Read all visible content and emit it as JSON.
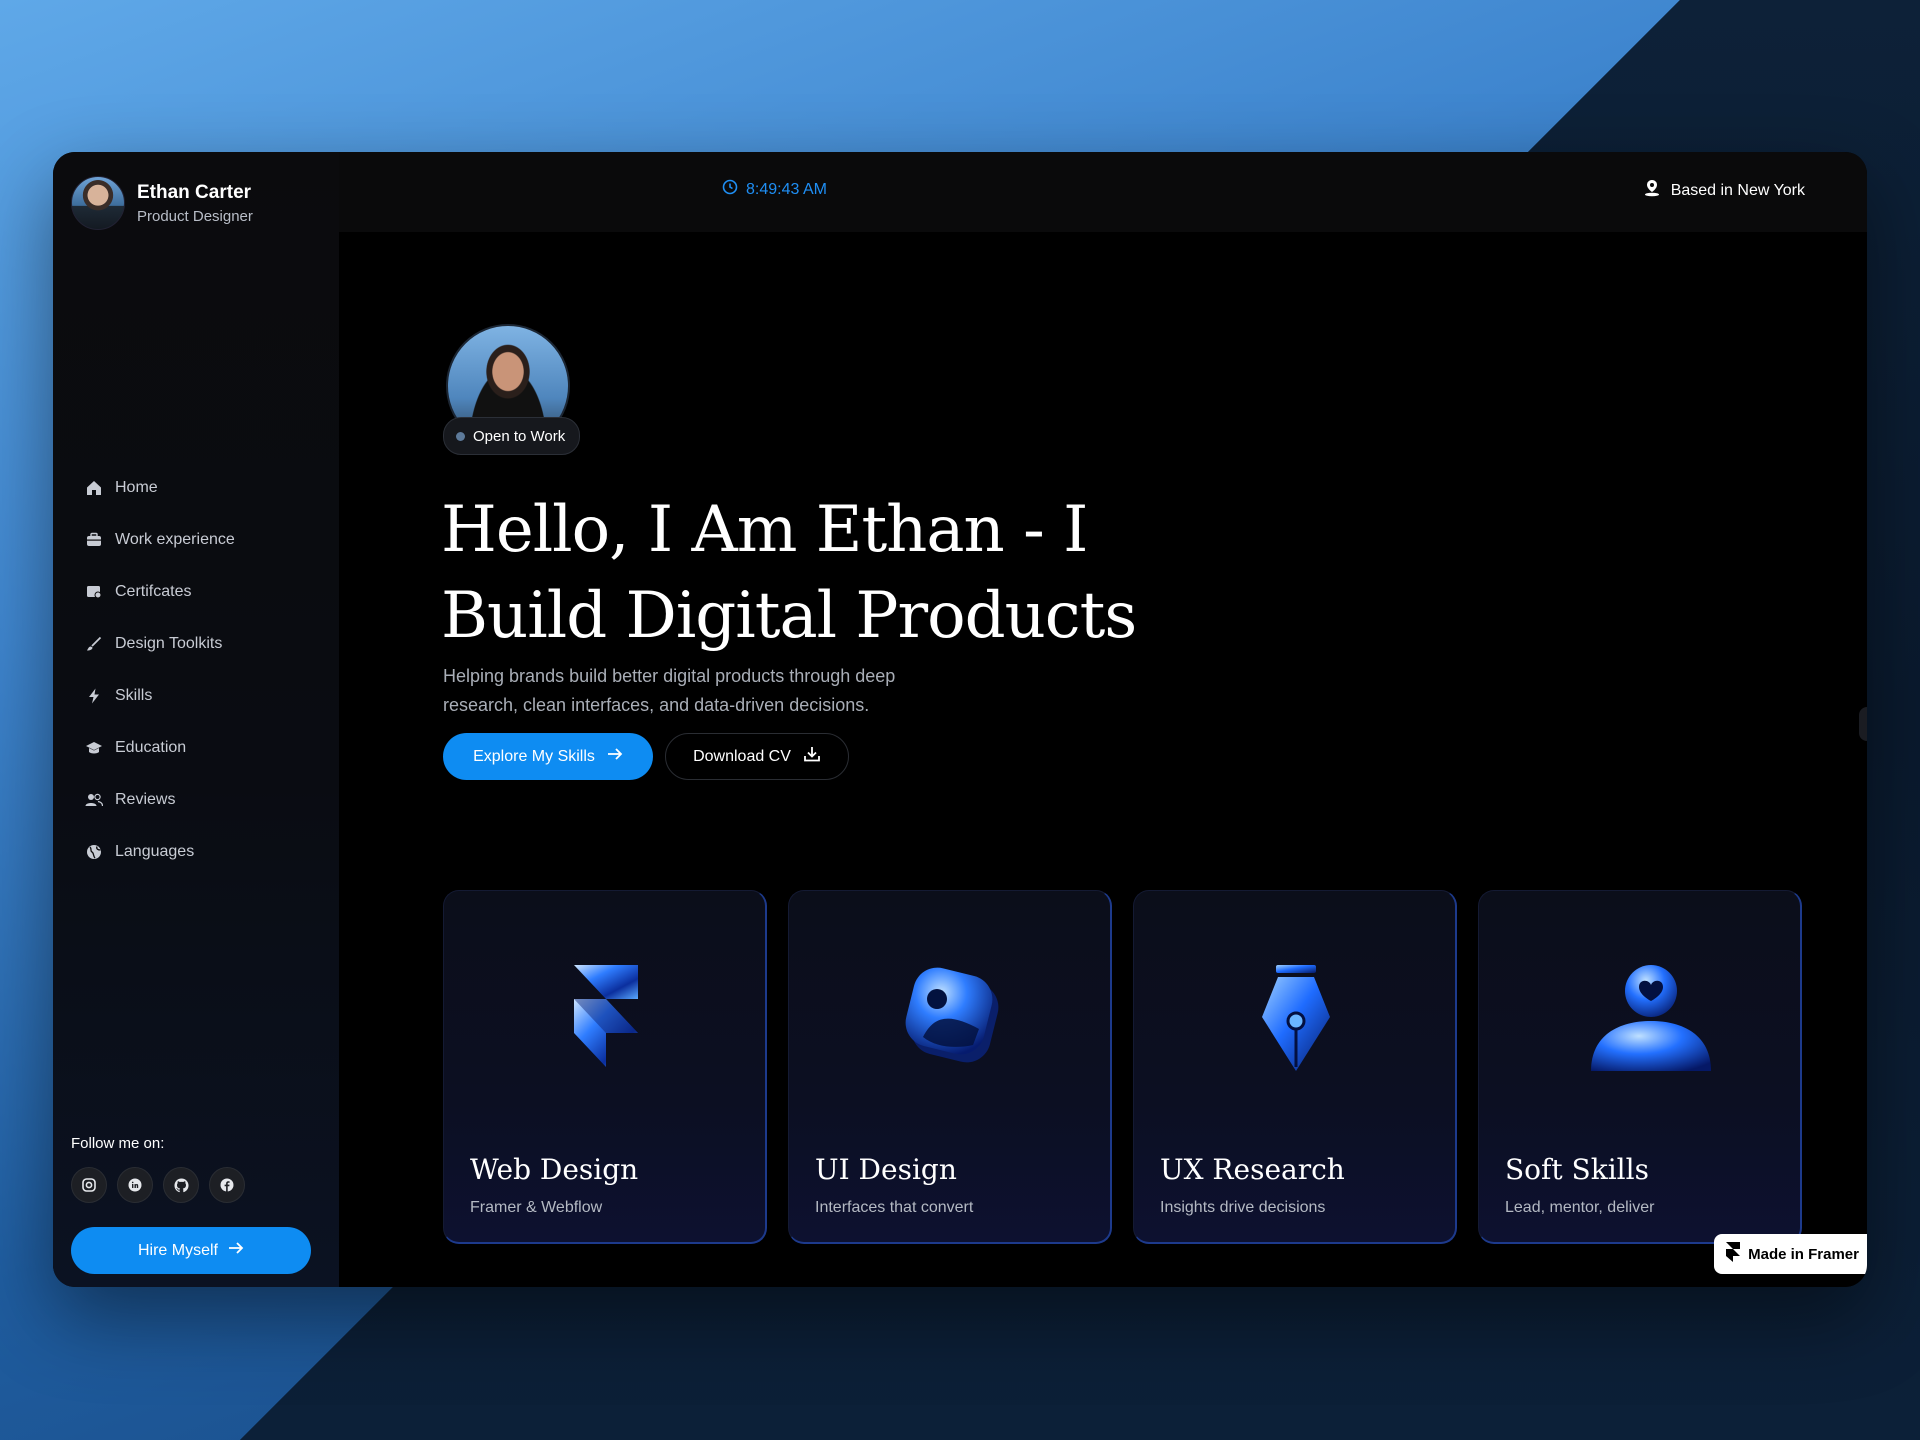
{
  "profile": {
    "name": "Ethan Carter",
    "role": "Product Designer"
  },
  "topbar": {
    "time": "8:49:43 AM",
    "location": "Based in New York"
  },
  "nav": {
    "items": [
      {
        "label": "Home",
        "icon": "home-icon"
      },
      {
        "label": "Work experience",
        "icon": "briefcase-icon"
      },
      {
        "label": "Certifcates",
        "icon": "certificate-icon"
      },
      {
        "label": "Design Toolkits",
        "icon": "brush-icon"
      },
      {
        "label": "Skills",
        "icon": "lightning-icon"
      },
      {
        "label": "Education",
        "icon": "graduation-cap-icon"
      },
      {
        "label": "Reviews",
        "icon": "users-icon"
      },
      {
        "label": "Languages",
        "icon": "globe-icon"
      }
    ]
  },
  "follow": {
    "label": "Follow me on:",
    "socials": [
      "instagram-icon",
      "linkedin-icon",
      "github-icon",
      "facebook-icon"
    ]
  },
  "hire_button": "Hire Myself",
  "hero": {
    "badge": "Open to Work",
    "headline_line1": "Hello, I Am Ethan - I",
    "headline_line2": "Build Digital Products",
    "subtitle": "Helping brands build better digital products through deep research, clean interfaces, and data-driven decisions.",
    "primary_button": "Explore My Skills",
    "secondary_button": "Download CV"
  },
  "cards": [
    {
      "title": "Web Design",
      "subtitle": "Framer & Webflow",
      "icon": "framer-logo-icon"
    },
    {
      "title": "UI Design",
      "subtitle": "Interfaces that convert",
      "icon": "image-icon"
    },
    {
      "title": "UX Research",
      "subtitle": "Insights drive decisions",
      "icon": "pen-nib-icon"
    },
    {
      "title": "Soft Skills",
      "subtitle": "Lead, mentor, deliver",
      "icon": "user-heart-icon"
    }
  ],
  "framer_badge": "Made in Framer",
  "colors": {
    "accent": "#0e8cf2",
    "clock": "#1f8ff5",
    "card_glow": "#1d3a8c"
  }
}
